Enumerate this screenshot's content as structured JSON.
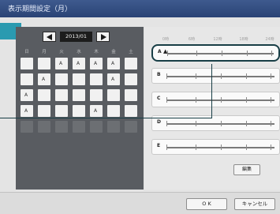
{
  "window": {
    "title": "表示期間設定（月）"
  },
  "calendar": {
    "prev_icon": "triangle-left-icon",
    "next_icon": "triangle-right-icon",
    "month": "2013/01",
    "weekdays": [
      "日",
      "月",
      "火",
      "水",
      "木",
      "金",
      "土"
    ],
    "rows": [
      [
        {
          "mark": ""
        },
        {
          "mark": ""
        },
        {
          "mark": "A"
        },
        {
          "mark": "A"
        },
        {
          "mark": "A"
        },
        {
          "mark": "A"
        },
        {
          "mark": ""
        }
      ],
      [
        {
          "mark": ""
        },
        {
          "mark": "A"
        },
        {
          "mark": ""
        },
        {
          "mark": ""
        },
        {
          "mark": ""
        },
        {
          "mark": "A"
        },
        {
          "mark": ""
        }
      ],
      [
        {
          "mark": "A"
        },
        {
          "mark": ""
        },
        {
          "mark": ""
        },
        {
          "mark": ""
        },
        {
          "mark": ""
        },
        {
          "mark": ""
        },
        {
          "mark": ""
        }
      ],
      [
        {
          "mark": "A"
        },
        {
          "mark": ""
        },
        {
          "mark": ""
        },
        {
          "mark": ""
        },
        {
          "mark": "A"
        },
        {
          "mark": ""
        },
        {
          "mark": ""
        }
      ],
      [
        {
          "mark": ""
        },
        {
          "mark": ""
        },
        {
          "mark": ""
        },
        {
          "mark": ""
        },
        {
          "mark": ""
        },
        {
          "mark": ""
        },
        {
          "mark": ""
        }
      ]
    ]
  },
  "schedule": {
    "hours": [
      "0時",
      "6時",
      "12時",
      "18時",
      "24時"
    ],
    "rows": [
      {
        "label": "A",
        "selected": true
      },
      {
        "label": "B",
        "selected": false
      },
      {
        "label": "C",
        "selected": false
      },
      {
        "label": "D",
        "selected": false
      },
      {
        "label": "E",
        "selected": false
      }
    ],
    "edit_label": "編集"
  },
  "footer": {
    "ok_label": "O K",
    "cancel_label": "キャンセル"
  },
  "colors": {
    "accent": "#2a9ab0",
    "callout": "#183e46",
    "calendar_bg": "#595c61"
  }
}
